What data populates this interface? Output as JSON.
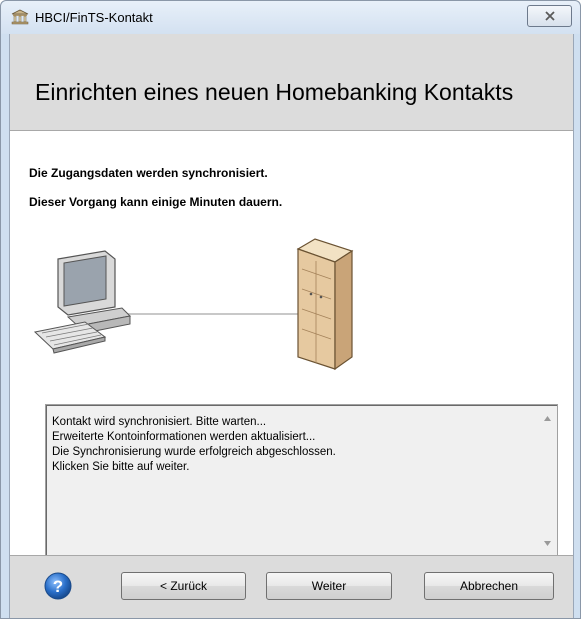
{
  "window": {
    "title": "HBCI/FinTS-Kontakt"
  },
  "header": {
    "title": "Einrichten eines neuen Homebanking Kontakts"
  },
  "messages": {
    "line1": "Die Zugangsdaten werden synchronisiert.",
    "line2": "Dieser Vorgang kann einige Minuten dauern."
  },
  "log": {
    "lines": [
      "Kontakt wird synchronisiert. Bitte warten...",
      "Erweiterte Kontoinformationen werden aktualisiert...",
      "Die Synchronisierung wurde erfolgreich abgeschlossen.",
      "Klicken Sie bitte auf weiter."
    ]
  },
  "footer": {
    "back_label": "< Zurück",
    "next_label": "Weiter",
    "cancel_label": "Abbrechen"
  },
  "colors": {
    "header_bg": "#dcdcdc",
    "help_blue": "#2a6fc9",
    "server_beige": "#e6c9a0"
  }
}
